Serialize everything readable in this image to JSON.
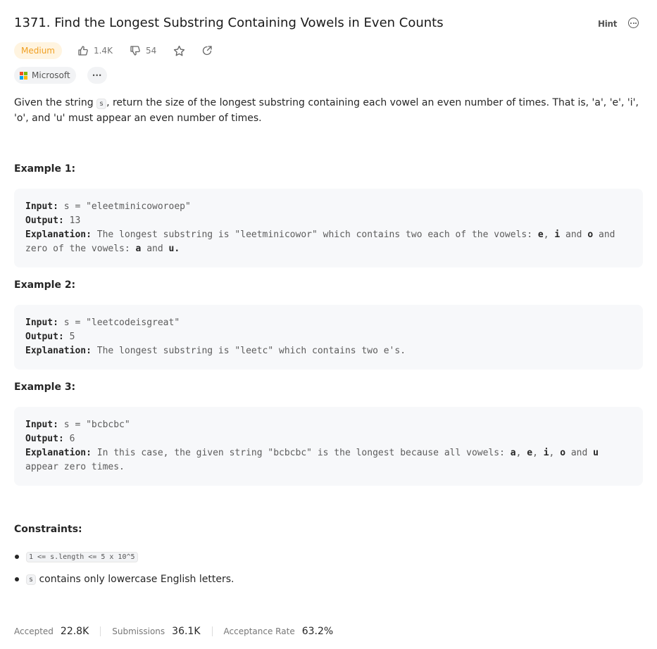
{
  "problem": {
    "title": "1371. Find the Longest Substring Containing Vowels in Even Counts",
    "difficulty": "Medium",
    "likes": "1.4K",
    "dislikes": "54",
    "hint_label": "Hint",
    "company": "Microsoft",
    "more_label": "···"
  },
  "description": {
    "part1": "Given the string ",
    "code": "s",
    "part2": ", return the size of the longest substring containing each vowel an even number of times. That is, 'a', 'e', 'i', 'o', and 'u' must appear an even number of times."
  },
  "examples": [
    {
      "heading": "Example 1:",
      "input_label": "Input:",
      "input": " s = \"eleetminicoworoep\"",
      "output_label": "Output:",
      "output": " 13",
      "explanation_label": "Explanation:",
      "explanation_text": " The longest substring is \"leetminicowor\" which contains two each of the vowels: ",
      "exp_b1": "e",
      "exp_t1": ", ",
      "exp_b2": "i",
      "exp_t2": " and ",
      "exp_b3": "o",
      "exp_t3": " and zero of the vowels: ",
      "exp_b4": "a",
      "exp_t4": " and ",
      "exp_b5": "u."
    },
    {
      "heading": "Example 2:",
      "input_label": "Input:",
      "input": " s = \"leetcodeisgreat\"",
      "output_label": "Output:",
      "output": " 5",
      "explanation_label": "Explanation:",
      "explanation_text": " The longest substring is \"leetc\" which contains two e's."
    },
    {
      "heading": "Example 3:",
      "input_label": "Input:",
      "input": " s = \"bcbcbc\"",
      "output_label": "Output:",
      "output": " 6",
      "explanation_label": "Explanation:",
      "explanation_text": " In this case, the given string \"bcbcbc\" is the longest because all vowels: ",
      "exp_b1": "a",
      "exp_t1": ", ",
      "exp_b2": "e",
      "exp_t2": ", ",
      "exp_b3": "i",
      "exp_t3": ", ",
      "exp_b4": "o",
      "exp_t4": " and ",
      "exp_b5": "u",
      "exp_t5": " appear zero times."
    }
  ],
  "constraints": {
    "heading": "Constraints:",
    "c1_code": "1 <= s.length <= 5 x 10^5",
    "c2_code": "s",
    "c2_text": " contains only lowercase English letters."
  },
  "stats": {
    "accepted_label": "Accepted",
    "accepted_value": "22.8K",
    "submissions_label": "Submissions",
    "submissions_value": "36.1K",
    "rate_label": "Acceptance Rate",
    "rate_value": "63.2%"
  },
  "colors": {
    "medium_text": "#f0a023",
    "medium_bg": "#fff4e0",
    "ms_red": "#f25022",
    "ms_green": "#7fba00",
    "ms_blue": "#00a4ef",
    "ms_yellow": "#ffb900"
  },
  "icons": [
    "thumbs-up-icon",
    "thumbs-down-icon",
    "star-icon",
    "share-icon",
    "more-horizontal-icon",
    "microsoft-logo-icon"
  ]
}
